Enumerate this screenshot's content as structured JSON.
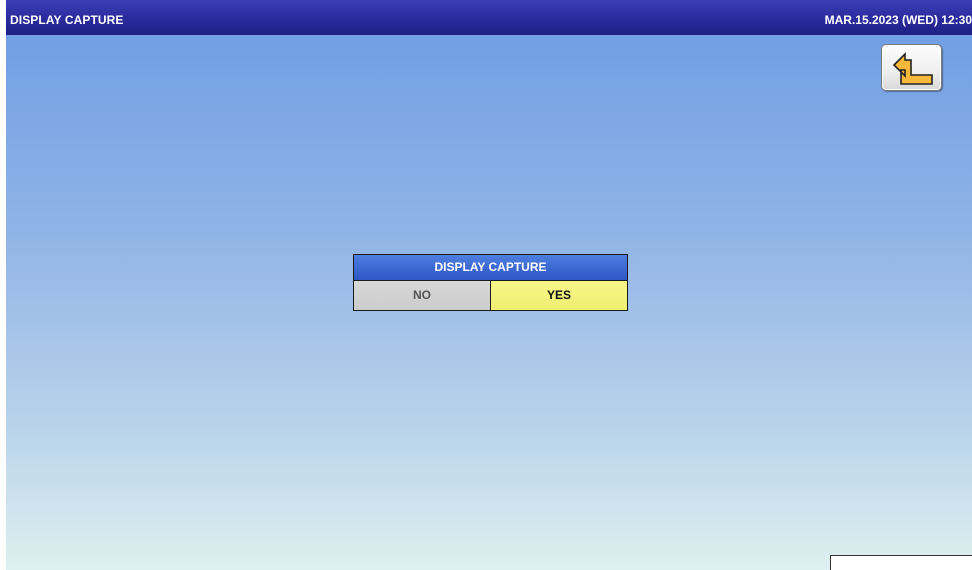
{
  "header": {
    "title": "DISPLAY CAPTURE",
    "datetime": "MAR.15.2023 (WED)  12:30"
  },
  "back_button": {
    "icon": "return-arrow-icon"
  },
  "dialog": {
    "title": "DISPLAY CAPTURE",
    "no_label": "NO",
    "yes_label": "YES"
  },
  "colors": {
    "title_bar": "#2a2a9c",
    "dialog_header": "#3b67d2",
    "yes_button": "#eeee70",
    "no_button": "#cccccc",
    "arrow_fill": "#f5b83a"
  }
}
